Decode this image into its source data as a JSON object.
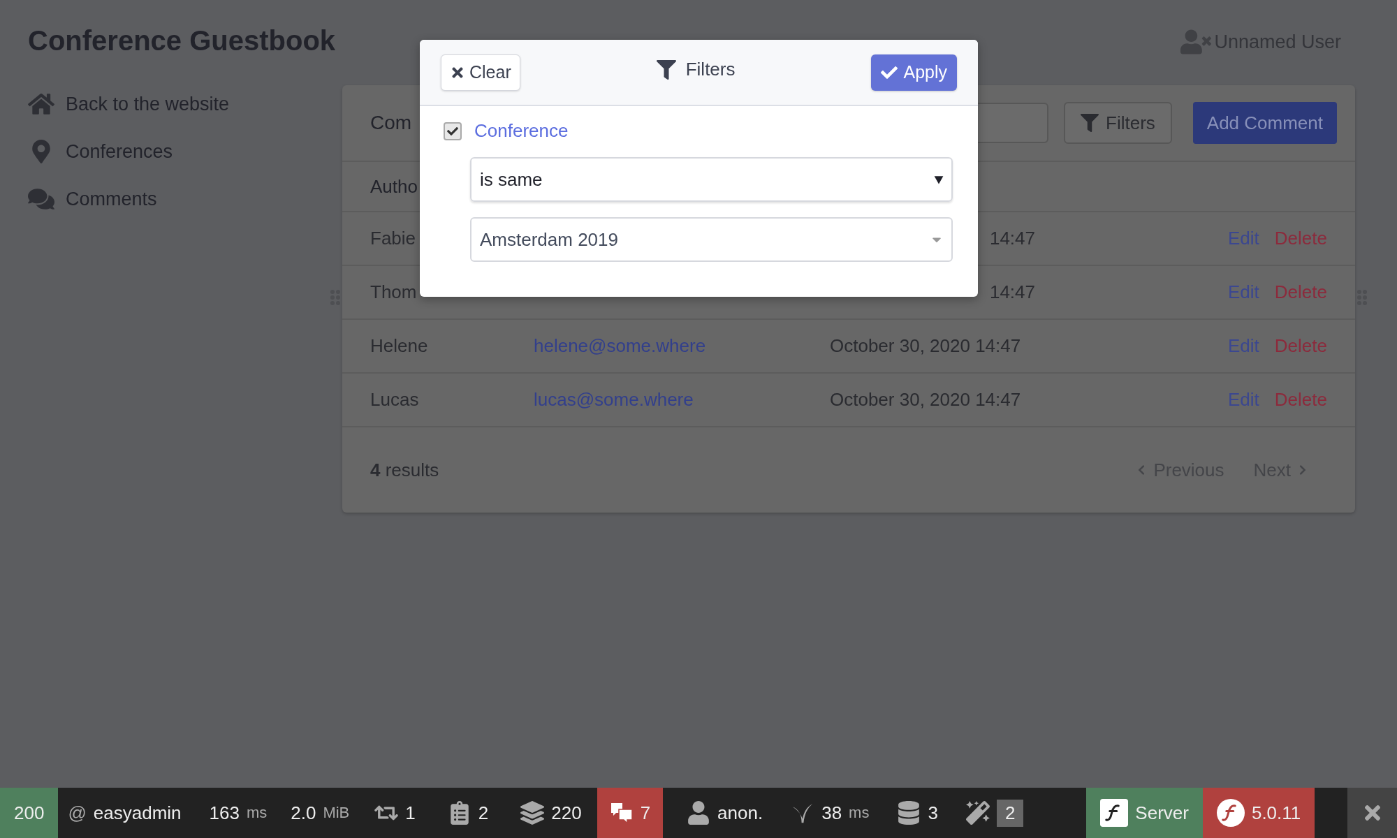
{
  "app": {
    "title": "Conference Guestbook"
  },
  "user": {
    "name": "Unnamed User"
  },
  "sidebar": {
    "items": [
      {
        "label": "Back to the website"
      },
      {
        "label": "Conferences"
      },
      {
        "label": "Comments"
      }
    ]
  },
  "panel": {
    "title": "Com",
    "filters_button": "Filters",
    "add_button": "Add Comment",
    "columns": [
      "Autho"
    ],
    "rows": [
      {
        "author": "Fabie",
        "date": "14:47",
        "actions": [
          "Edit",
          "Delete"
        ]
      },
      {
        "author": "Thom",
        "date": "14:47",
        "actions": [
          "Edit",
          "Delete"
        ]
      },
      {
        "author": "Helene",
        "email": "helene@some.where",
        "date": "October 30, 2020 14:47",
        "actions": [
          "Edit",
          "Delete"
        ]
      },
      {
        "author": "Lucas",
        "email": "lucas@some.where",
        "date": "October 30, 2020 14:47",
        "actions": [
          "Edit",
          "Delete"
        ]
      }
    ],
    "results": "**4** results",
    "pagination": [
      {
        "label": "Previous",
        "disabled": true
      },
      {
        "label": "Next",
        "disabled": true
      }
    ]
  },
  "filters_modal": {
    "clear": "Clear",
    "title": "Filters",
    "apply": "Apply",
    "filters": [
      {
        "label": "Conference",
        "checked": true,
        "comparison": "is same",
        "value": "Amsterdam 2019"
      }
    ]
  },
  "toolbar": {
    "items": [
      {
        "kind": "status",
        "value": "200"
      },
      {
        "kind": "route",
        "prefix": "@",
        "value": "easyadmin"
      },
      {
        "kind": "metric",
        "value": "163",
        "unit": "ms"
      },
      {
        "kind": "metric",
        "value": "2.0",
        "unit": "MiB"
      },
      {
        "kind": "count",
        "value": "1"
      },
      {
        "kind": "count",
        "value": "2"
      },
      {
        "kind": "count",
        "value": "220"
      },
      {
        "kind": "alert",
        "value": "7"
      },
      {
        "kind": "count",
        "value": "anon."
      },
      {
        "kind": "metric",
        "value": "38",
        "unit": "ms"
      },
      {
        "kind": "count",
        "value": "3"
      },
      {
        "kind": "badge",
        "value": "2"
      },
      {
        "kind": "server",
        "value": "Server"
      },
      {
        "kind": "version",
        "value": "5.0.11"
      }
    ]
  }
}
